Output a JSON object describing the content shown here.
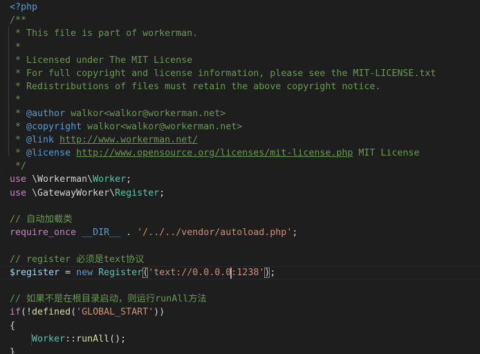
{
  "editor": {
    "language": "php",
    "theme": "dark-plus",
    "background_color": "#1e1e1e",
    "default_text_color": "#d4d4d4",
    "font_size_px": 13.3,
    "line_height_px": 19.2,
    "cursor_color": "#aeafad",
    "active_line_border_color": "#282828",
    "indent_guide_color": "#404040",
    "bracket_match_border_color": "#888888",
    "colors": {
      "comment": "#6a9955",
      "doc_tag": "#569cd6",
      "url": "#6a9955",
      "keyword": "#569cd6",
      "control_keyword": "#c586c0",
      "class_name": "#4ec9b0",
      "string": "#ce9178",
      "variable": "#9cdcfe",
      "function": "#dcdcaa",
      "constant": "#569cd6"
    }
  },
  "code": {
    "lines": [
      {
        "n": 1,
        "tokens": [
          {
            "text": "<?php",
            "cls": "t-tag"
          }
        ]
      },
      {
        "n": 2,
        "tokens": [
          {
            "text": "/**",
            "cls": "t-comment"
          }
        ]
      },
      {
        "n": 3,
        "tokens": [
          {
            "text": " * This file is part of workerman.",
            "cls": "t-comment"
          }
        ]
      },
      {
        "n": 4,
        "tokens": [
          {
            "text": " *",
            "cls": "t-comment"
          }
        ]
      },
      {
        "n": 5,
        "tokens": [
          {
            "text": " * Licensed under The MIT License",
            "cls": "t-comment"
          }
        ]
      },
      {
        "n": 6,
        "tokens": [
          {
            "text": " * For full copyright and license information, please see the MIT-LICENSE.txt",
            "cls": "t-comment"
          }
        ]
      },
      {
        "n": 7,
        "tokens": [
          {
            "text": " * Redistributions of files must retain the above copyright notice.",
            "cls": "t-comment"
          }
        ]
      },
      {
        "n": 8,
        "tokens": [
          {
            "text": " *",
            "cls": "t-comment"
          }
        ]
      },
      {
        "n": 9,
        "tokens": [
          {
            "text": " * ",
            "cls": "t-comment"
          },
          {
            "text": "@author",
            "cls": "t-doctag"
          },
          {
            "text": " walkor<walkor@workerman.net>",
            "cls": "t-comment"
          }
        ]
      },
      {
        "n": 10,
        "tokens": [
          {
            "text": " * ",
            "cls": "t-comment"
          },
          {
            "text": "@copyright",
            "cls": "t-doctag"
          },
          {
            "text": " walkor<walkor@workerman.net>",
            "cls": "t-comment"
          }
        ]
      },
      {
        "n": 11,
        "tokens": [
          {
            "text": " * ",
            "cls": "t-comment"
          },
          {
            "text": "@link",
            "cls": "t-doctag"
          },
          {
            "text": " ",
            "cls": "t-comment"
          },
          {
            "text": "http://www.workerman.net/",
            "cls": "t-url"
          }
        ]
      },
      {
        "n": 12,
        "tokens": [
          {
            "text": " * ",
            "cls": "t-comment"
          },
          {
            "text": "@license",
            "cls": "t-doctag"
          },
          {
            "text": " ",
            "cls": "t-comment"
          },
          {
            "text": "http://www.opensource.org/licenses/mit-license.php",
            "cls": "t-url"
          },
          {
            "text": " MIT License",
            "cls": "t-comment"
          }
        ]
      },
      {
        "n": 13,
        "tokens": [
          {
            "text": " */",
            "cls": "t-comment"
          }
        ]
      },
      {
        "n": 14,
        "tokens": [
          {
            "text": "use",
            "cls": "t-control"
          },
          {
            "text": " \\Workerman\\",
            "cls": "t-default"
          },
          {
            "text": "Worker",
            "cls": "t-class"
          },
          {
            "text": ";",
            "cls": "t-punct"
          }
        ]
      },
      {
        "n": 15,
        "tokens": [
          {
            "text": "use",
            "cls": "t-control"
          },
          {
            "text": " \\GatewayWorker\\",
            "cls": "t-default"
          },
          {
            "text": "Register",
            "cls": "t-class"
          },
          {
            "text": ";",
            "cls": "t-punct"
          }
        ]
      },
      {
        "n": 16,
        "tokens": []
      },
      {
        "n": 17,
        "tokens": [
          {
            "text": "// 自动加载类",
            "cls": "t-comment"
          }
        ]
      },
      {
        "n": 18,
        "tokens": [
          {
            "text": "require_once",
            "cls": "t-control"
          },
          {
            "text": " ",
            "cls": "t-default"
          },
          {
            "text": "__DIR__",
            "cls": "t-constant"
          },
          {
            "text": " . ",
            "cls": "t-default"
          },
          {
            "text": "'/../../vendor/autoload.php'",
            "cls": "t-string"
          },
          {
            "text": ";",
            "cls": "t-punct"
          }
        ]
      },
      {
        "n": 19,
        "tokens": []
      },
      {
        "n": 20,
        "tokens": [
          {
            "text": "// register 必须是text协议",
            "cls": "t-comment"
          }
        ]
      },
      {
        "n": 21,
        "active": true,
        "tokens": [
          {
            "text": "$register",
            "cls": "t-variable"
          },
          {
            "text": " = ",
            "cls": "t-default"
          },
          {
            "text": "new",
            "cls": "t-keyword"
          },
          {
            "text": " ",
            "cls": "t-default"
          },
          {
            "text": "Register",
            "cls": "t-class"
          },
          {
            "text": "(",
            "cls": "t-punct",
            "bracket_match": true
          },
          {
            "text": "'text://0.0.0.0",
            "cls": "t-string"
          },
          {
            "text": "",
            "caret": true
          },
          {
            "text": ":1238'",
            "cls": "t-string"
          },
          {
            "text": ")",
            "cls": "t-punct",
            "bracket_match": true
          },
          {
            "text": ";",
            "cls": "t-punct"
          }
        ]
      },
      {
        "n": 22,
        "tokens": []
      },
      {
        "n": 23,
        "tokens": [
          {
            "text": "// 如果不是在根目录启动，则运行runAll方法",
            "cls": "t-comment"
          }
        ]
      },
      {
        "n": 24,
        "tokens": [
          {
            "text": "if",
            "cls": "t-control"
          },
          {
            "text": "(!",
            "cls": "t-punct"
          },
          {
            "text": "defined",
            "cls": "t-function"
          },
          {
            "text": "(",
            "cls": "t-punct"
          },
          {
            "text": "'GLOBAL_START'",
            "cls": "t-string"
          },
          {
            "text": "))",
            "cls": "t-punct"
          }
        ]
      },
      {
        "n": 25,
        "tokens": [
          {
            "text": "{",
            "cls": "t-punct"
          }
        ]
      },
      {
        "n": 26,
        "tokens": [
          {
            "text": "    ",
            "cls": "t-default"
          },
          {
            "text": "Worker",
            "cls": "t-class"
          },
          {
            "text": "::",
            "cls": "t-punct"
          },
          {
            "text": "runAll",
            "cls": "t-function"
          },
          {
            "text": "();",
            "cls": "t-punct"
          }
        ]
      },
      {
        "n": 27,
        "tokens": [
          {
            "text": "}",
            "cls": "t-punct"
          }
        ]
      }
    ]
  }
}
